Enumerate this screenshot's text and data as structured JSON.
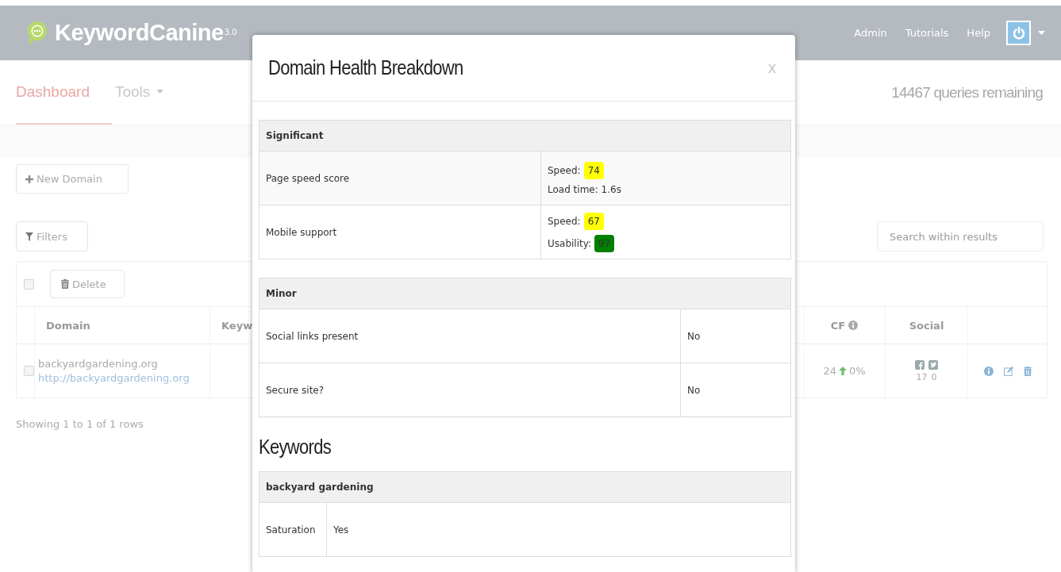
{
  "navbar": {
    "brand": "KeywordCanine",
    "version": "3.0",
    "links": [
      "Admin",
      "Tutorials",
      "Help"
    ]
  },
  "nav_tabs": [
    {
      "label": "Dashboard",
      "selected": true,
      "dropdown": false
    },
    {
      "label": "Tools",
      "selected": false,
      "dropdown": true
    }
  ],
  "queries_remaining": "14467 queries remaining",
  "new_domain_button": "New Domain",
  "filters_button": "Filters",
  "search": {
    "placeholder": "Search within results"
  },
  "select_all": {
    "checked": false
  },
  "delete_button": "Delete",
  "table": {
    "columns": [
      {
        "label": "Domain",
        "info": false
      },
      {
        "label": "Keyw",
        "info": false
      },
      {
        "label": "CF",
        "info": true
      },
      {
        "label": "Social",
        "info": false
      }
    ],
    "rows": [
      {
        "checked": false,
        "domain": "backyardgardening.org",
        "url": "http://backyardgardening.org",
        "cf": "24",
        "cf_change": "0%",
        "facebook": "17",
        "twitter": "0"
      }
    ]
  },
  "table_footer": "Showing 1 to 1 of 1 rows",
  "modal": {
    "title": "Domain Health Breakdown",
    "close": "x",
    "sections": [
      {
        "heading": "Significant",
        "kind": "scores",
        "rows": [
          {
            "label": "Page speed score",
            "lines": [
              {
                "text": "Speed:",
                "badge": "74",
                "color": "#ffff00"
              },
              {
                "text": "Load time: 1.6s"
              }
            ]
          },
          {
            "label": "Mobile support",
            "lines": [
              {
                "text": "Speed:",
                "badge": "67",
                "color": "#ffff00"
              },
              {
                "text": "Usability:",
                "badge": "97",
                "color": "#008000"
              }
            ]
          }
        ]
      },
      {
        "heading": "Minor",
        "kind": "checks",
        "rows": [
          {
            "label": "Social links present",
            "lines": [
              {
                "text": "No"
              }
            ]
          },
          {
            "label": "Secure site?",
            "lines": [
              {
                "text": "No"
              }
            ]
          }
        ]
      }
    ],
    "keywords_heading": "Keywords",
    "keyword_sections": [
      {
        "heading": "backyard gardening",
        "rows": [
          {
            "label": "Saturation",
            "lines": [
              {
                "text": "Yes"
              }
            ]
          }
        ]
      }
    ]
  }
}
